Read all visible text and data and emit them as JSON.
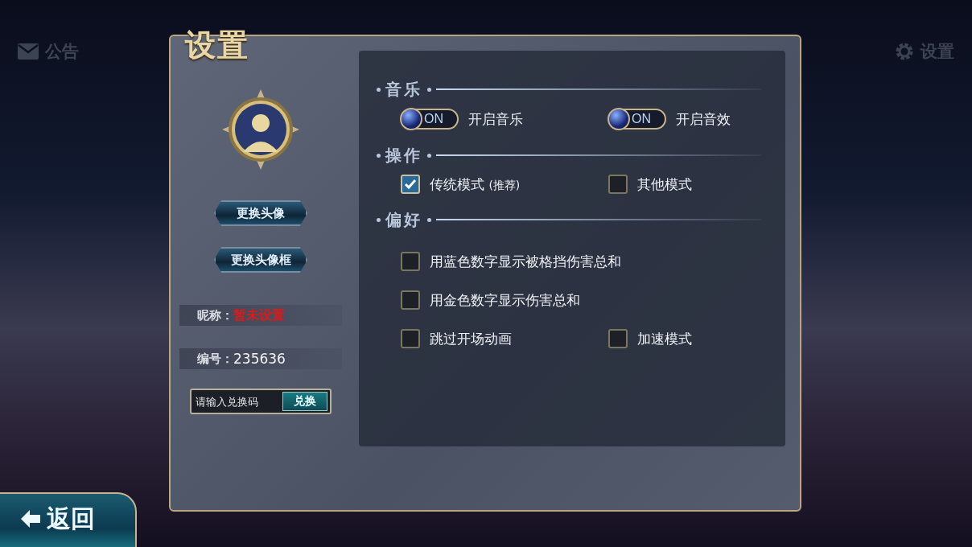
{
  "top_bar": {
    "announcement": "公告",
    "settings": "设置"
  },
  "dialog": {
    "title": "设置",
    "profile": {
      "buttons": [
        "更换头像",
        "更换头像框"
      ],
      "nickname_label": "昵称：",
      "nickname": "暂未设置",
      "id_label": "编号：",
      "id": "235636",
      "redeem": {
        "placeholder": "请输入兑换码",
        "button": "兑换"
      }
    },
    "sections": [
      {
        "title": "音乐",
        "rows": [
          {
            "options": [
              {
                "kind": "toggle",
                "on": true,
                "state_text": "ON",
                "label": "开启音乐"
              },
              {
                "kind": "toggle",
                "on": true,
                "state_text": "ON",
                "label": "开启音效"
              }
            ]
          }
        ]
      },
      {
        "title": "操作",
        "rows": [
          {
            "options": [
              {
                "kind": "checkbox",
                "checked": true,
                "label": "传统模式",
                "note": "(推荐)"
              },
              {
                "kind": "checkbox",
                "checked": false,
                "label": "其他模式"
              }
            ]
          }
        ]
      },
      {
        "title": "偏好",
        "rows": [
          {
            "options": [
              {
                "kind": "checkbox",
                "checked": false,
                "label": "用蓝色数字显示被格挡伤害总和"
              }
            ]
          },
          {
            "options": [
              {
                "kind": "checkbox",
                "checked": false,
                "label": "用金色数字显示伤害总和"
              }
            ]
          },
          {
            "options": [
              {
                "kind": "checkbox",
                "checked": false,
                "label": "跳过开场动画"
              },
              {
                "kind": "checkbox",
                "checked": false,
                "label": "加速模式"
              }
            ]
          }
        ]
      }
    ]
  },
  "back_button": "返回"
}
